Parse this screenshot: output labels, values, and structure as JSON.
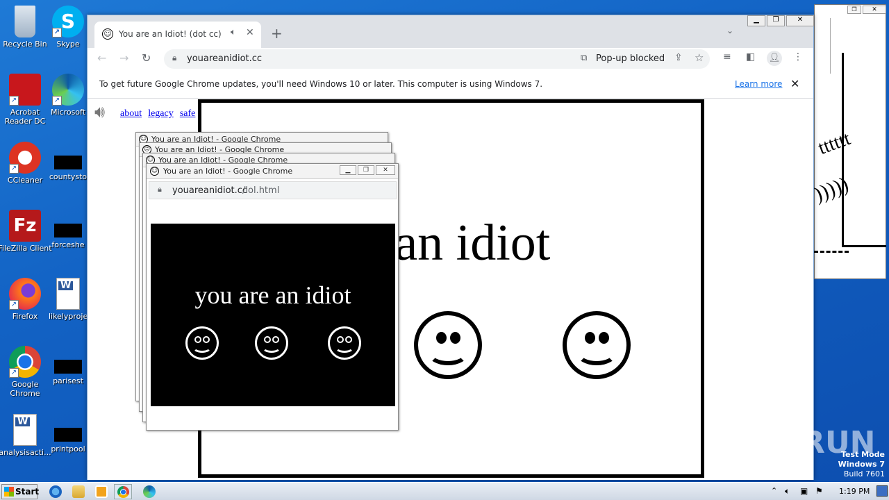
{
  "desktop": {
    "icons_left": [
      {
        "label": "Recycle Bin"
      },
      {
        "label": "Acrobat Reader DC"
      },
      {
        "label": "CCleaner"
      },
      {
        "label": "FileZilla Client"
      },
      {
        "label": "Firefox"
      },
      {
        "label": "Google Chrome"
      },
      {
        "label": "analysisacti..."
      }
    ],
    "icons_right": [
      {
        "label": "Skype"
      },
      {
        "label": "Microsoft"
      },
      {
        "label": "countysto"
      },
      {
        "label": "forceshe"
      },
      {
        "label": "likelyproje"
      },
      {
        "label": "parisest"
      },
      {
        "label": "printpool"
      }
    ],
    "watermark": "ANY RUN",
    "test_mode": {
      "line1": "Test Mode",
      "line2": "Windows 7",
      "line3": "Build 7601"
    }
  },
  "browser": {
    "tab_title": "You are an Idiot! (dot cc)",
    "url": "youareanidiot.cc",
    "popup_blocked": "Pop-up blocked",
    "infobar_text": "To get future Google Chrome updates, you'll need Windows 10 or later. This computer is using Windows 7.",
    "infobar_link": "Learn more",
    "page": {
      "links": [
        "about",
        "legacy",
        "safe"
      ],
      "headline": "you are an idiot"
    }
  },
  "popups": {
    "title": "You are an Idiot! - Google Chrome",
    "url_host": "youareanidiot.cc",
    "url_path": "/lol.html",
    "headline": "you are an idiot"
  },
  "right_stack": {
    "text1": "tttttt",
    "text2": ")))))"
  },
  "taskbar": {
    "start": "Start",
    "time": "1:19 PM"
  },
  "colors": {
    "desktop": "#1565c8",
    "chrome_tabstrip": "#dee1e6",
    "link": "#0000ee",
    "infobar_link": "#1a73e8"
  }
}
